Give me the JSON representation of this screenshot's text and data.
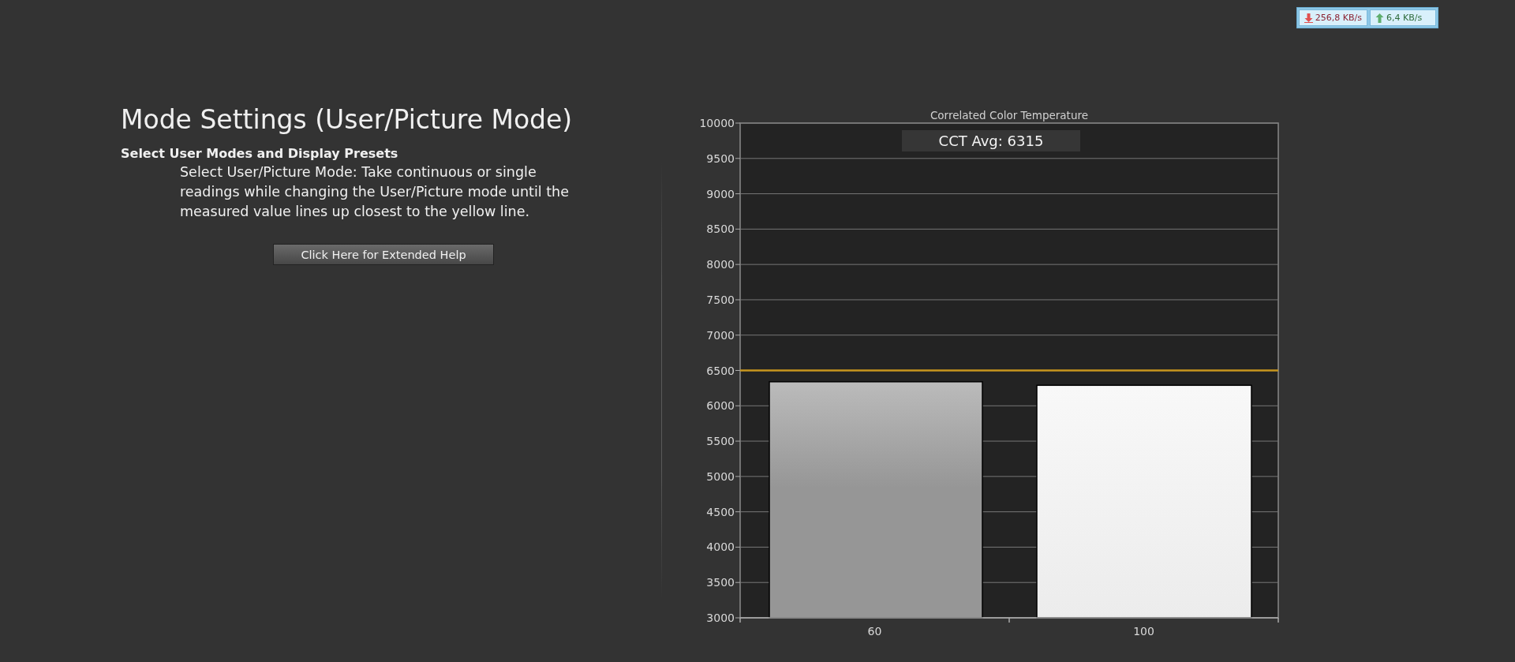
{
  "network_meter": {
    "download": "256,8 KB/s",
    "upload": "6,4 KB/s"
  },
  "mode_settings": {
    "title": "Mode Settings (User/Picture Mode)",
    "subtitle": "Select User Modes and Display Presets",
    "description": "Select User/Picture Mode: Take continuous or single readings while changing the User/Picture mode until the measured value lines up closest to the yellow line.",
    "help_button": "Click Here for Extended Help"
  },
  "cct_chart": {
    "average_label": "CCT Avg: 6315",
    "chart_data": {
      "type": "bar",
      "title": "Correlated Color Temperature",
      "categories": [
        "60",
        "100"
      ],
      "values": [
        6340,
        6290
      ],
      "grid": true,
      "ylim": [
        3000,
        10000
      ],
      "yticks": [
        3000,
        3500,
        4000,
        4500,
        5000,
        5500,
        6000,
        6500,
        7000,
        7500,
        8000,
        8500,
        9000,
        9500,
        10000
      ],
      "ref_lines": [
        {
          "axis": "y",
          "value": 6500,
          "color": "#c8961e"
        }
      ]
    }
  }
}
